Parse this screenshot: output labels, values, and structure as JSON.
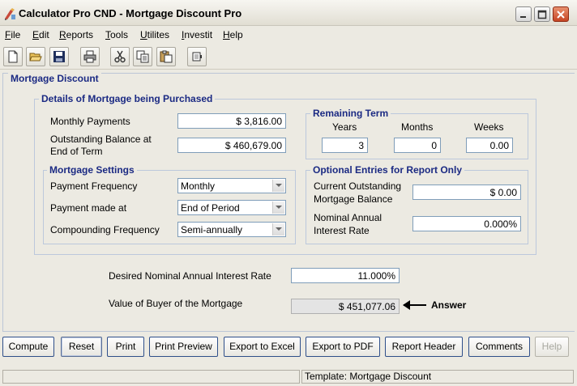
{
  "window": {
    "title": "Calculator Pro CND - Mortgage Discount Pro"
  },
  "menu": [
    {
      "key": "F",
      "rest": "ile"
    },
    {
      "key": "E",
      "rest": "dit"
    },
    {
      "key": "R",
      "rest": "eports"
    },
    {
      "key": "T",
      "rest": "ools"
    },
    {
      "key": "U",
      "rest": "tilites"
    },
    {
      "key": "I",
      "rest": "nvestit"
    },
    {
      "key": "H",
      "rest": "elp"
    }
  ],
  "toolbar_icons": [
    "new-file-icon",
    "open-folder-icon",
    "save-icon",
    "print-icon",
    "cut-icon",
    "copy-icon",
    "paste-icon",
    "calculator-icon"
  ],
  "panel": {
    "title": "Mortgage Discount"
  },
  "details": {
    "title": "Details of Mortgage being Purchased",
    "monthly_payments_label": "Monthly Payments",
    "monthly_payments_value": "$ 3,816.00",
    "outstanding_label_1": "Outstanding Balance at",
    "outstanding_label_2": "End of Term",
    "outstanding_value": "$ 460,679.00"
  },
  "remaining": {
    "title": "Remaining Term",
    "years_label": "Years",
    "months_label": "Months",
    "weeks_label": "Weeks",
    "years_value": "3",
    "months_value": "0",
    "weeks_value": "0.00"
  },
  "settings": {
    "title": "Mortgage Settings",
    "frequency_label": "Payment Frequency",
    "frequency_value": "Monthly",
    "made_at_label": "Payment made at",
    "made_at_value": "End of Period",
    "compounding_label": "Compounding Frequency",
    "compounding_value": "Semi-annually"
  },
  "optional": {
    "title": "Optional Entries for Report Only",
    "current_label_1": "Current Outstanding",
    "current_label_2": "Mortgage Balance",
    "current_value": "$ 0.00",
    "nominal_label_1": "Nominal Annual",
    "nominal_label_2": "Interest Rate",
    "nominal_value": "0.000%"
  },
  "results": {
    "desired_rate_label": "Desired Nominal Annual Interest Rate",
    "desired_rate_value": "11.000%",
    "value_label": "Value of Buyer of the Mortgage",
    "value_value": "$ 451,077.06",
    "answer_label": "Answer"
  },
  "buttons": {
    "compute": "Compute",
    "reset": "Reset",
    "print": "Print",
    "print_preview": "Print Preview",
    "export_excel": "Export to Excel",
    "export_pdf": "Export to PDF",
    "report_header": "Report Header",
    "comments": "Comments",
    "help": "Help"
  },
  "status": {
    "left": "",
    "template": "Template: Mortgage Discount"
  },
  "colors": {
    "group_title": "#1b2a83",
    "background": "#eceae2",
    "field_border": "#7f9db9"
  }
}
